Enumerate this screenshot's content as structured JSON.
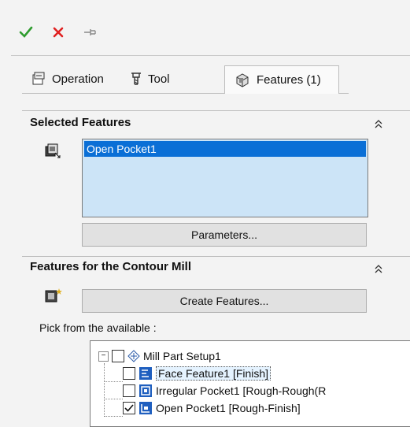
{
  "toolbar": {
    "ok_icon": "checkmark-icon",
    "cancel_icon": "close-icon",
    "pin_icon": "pushpin-icon",
    "ok_color": "#2e9c2e",
    "cancel_color": "#e02020"
  },
  "tabs": [
    {
      "label": "Operation",
      "icon": "operation-icon"
    },
    {
      "label": "Tool",
      "icon": "tool-icon"
    },
    {
      "label": "Features (1)",
      "icon": "features-cube-icon",
      "active": true
    }
  ],
  "selected_features": {
    "title": "Selected Features",
    "items": [
      "Open Pocket1"
    ],
    "parameters_label": "Parameters..."
  },
  "contour_mill": {
    "title": "Features for the Contour Mill",
    "create_label": "Create Features...",
    "pick_label": "Pick from the available :",
    "tree": {
      "root": "Mill Part Setup1",
      "children": [
        {
          "label": "Face Feature1 [Finish]",
          "checked": false,
          "selected": true
        },
        {
          "label": "Irregular Pocket1 [Rough-Rough(R",
          "checked": false,
          "selected": false
        },
        {
          "label": "Open Pocket1 [Rough-Finish]",
          "checked": true,
          "selected": false
        }
      ]
    }
  },
  "colors": {
    "selection": "#0a6fd6",
    "listbox_bg": "#cce4f7"
  }
}
